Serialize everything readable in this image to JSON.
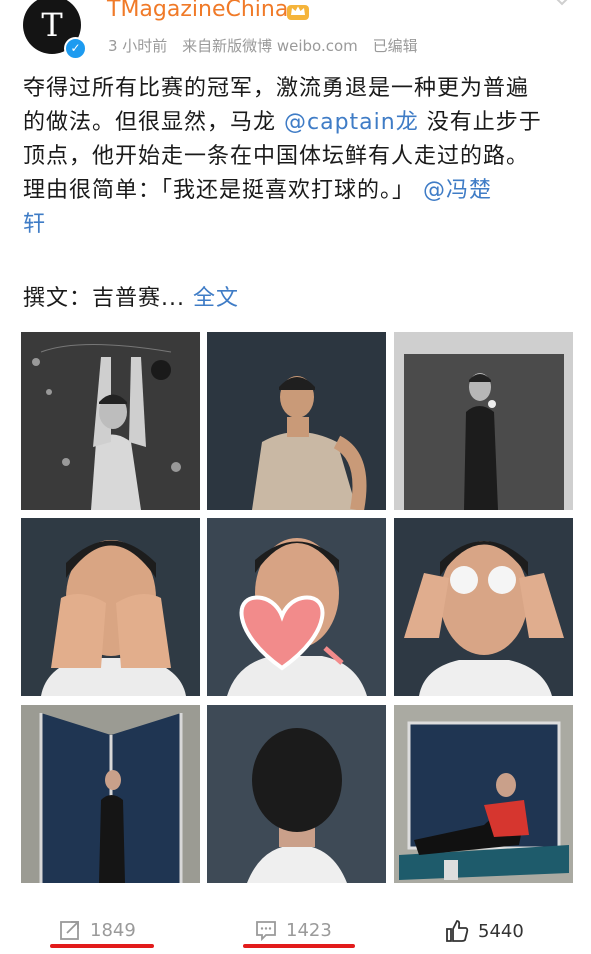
{
  "post": {
    "username": "TMagazineChina",
    "avatar_letter": "T",
    "time": "3 小时前",
    "source": "来自新版微博 weibo.com",
    "edited": "已编辑",
    "line1": "夺得过所有比赛的冠军，激流勇退是一种更为普遍",
    "line2_pre": "的做法。但很显然，马龙 ",
    "line2_mention": "@captain龙",
    "line2_post": " 没有止步于",
    "line3": "顶点，他开始走一条在中国体坛鲜有人走过的路。",
    "line4_pre": "理由很简单：「我还是挺喜欢打球的。」 ",
    "line4_mention": "@冯楚",
    "line5_mention": "轩",
    "byline": "撰文：吉普赛...",
    "fulltext_link": "全文"
  },
  "actions": {
    "repost_count": "1849",
    "comment_count": "1423",
    "like_count": "5440"
  },
  "icons": {
    "verified": "verified-badge-icon",
    "crown": "crown-member-icon",
    "more": "chevron-down-icon",
    "repost": "repost-icon",
    "comment": "comment-icon",
    "like": "thumbs-up-icon"
  },
  "colors": {
    "username": "#f07a28",
    "mention": "#3f7cc6",
    "underline": "#e21b1b"
  }
}
